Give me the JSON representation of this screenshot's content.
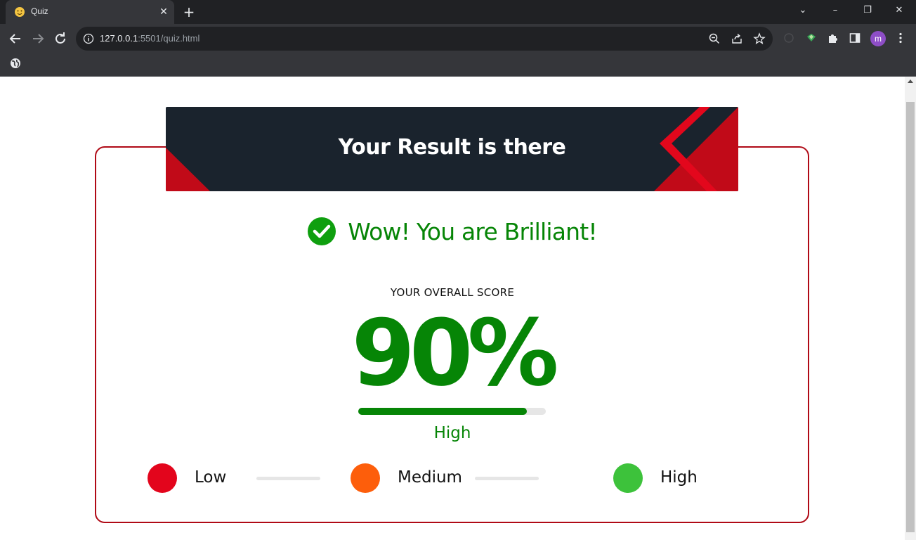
{
  "browser": {
    "tab_title": "Quiz",
    "url_host": "127.0.0.1",
    "url_rest": ":5501/quiz.html",
    "profile_initial": "m"
  },
  "page": {
    "banner_title": "Your Result is there",
    "headline": "Wow! You are Brilliant!",
    "score_label": "YOUR OVERALL SCORE",
    "score_value": "90%",
    "score_fraction": 0.9,
    "level": "High",
    "legend": [
      {
        "label": "Low",
        "color": "#e3051c"
      },
      {
        "label": "Medium",
        "color": "#fd5e0b"
      },
      {
        "label": "High",
        "color": "#3dc23b"
      }
    ],
    "colors": {
      "accent_green": "#068506",
      "accent_red": "#b00a16",
      "banner_bg": "#1a232d"
    }
  }
}
